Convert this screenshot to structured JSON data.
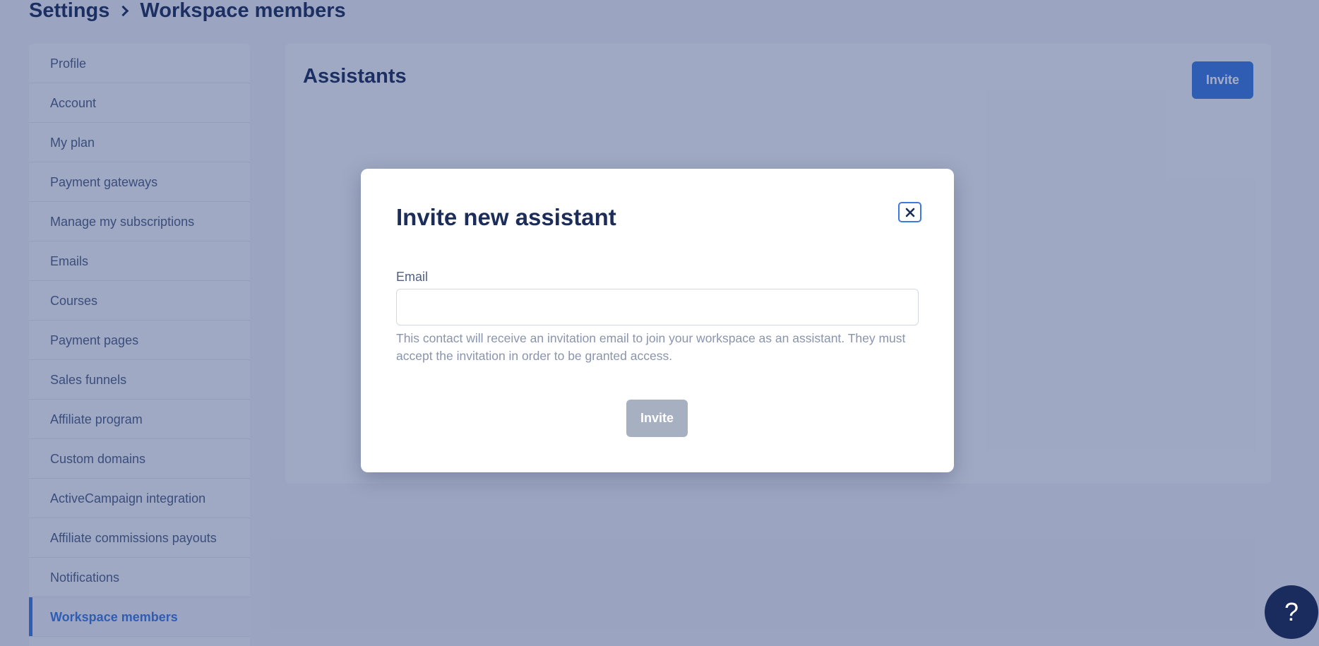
{
  "breadcrumb": {
    "root": "Settings",
    "current": "Workspace members"
  },
  "sidebar": {
    "items": [
      {
        "label": "Profile",
        "active": false
      },
      {
        "label": "Account",
        "active": false
      },
      {
        "label": "My plan",
        "active": false
      },
      {
        "label": "Payment gateways",
        "active": false
      },
      {
        "label": "Manage my subscriptions",
        "active": false
      },
      {
        "label": "Emails",
        "active": false
      },
      {
        "label": "Courses",
        "active": false
      },
      {
        "label": "Payment pages",
        "active": false
      },
      {
        "label": "Sales funnels",
        "active": false
      },
      {
        "label": "Affiliate program",
        "active": false
      },
      {
        "label": "Custom domains",
        "active": false
      },
      {
        "label": "ActiveCampaign integration",
        "active": false
      },
      {
        "label": "Affiliate commissions payouts",
        "active": false
      },
      {
        "label": "Notifications",
        "active": false
      },
      {
        "label": "Workspace members",
        "active": true
      }
    ]
  },
  "main": {
    "title": "Assistants",
    "invite_label": "Invite"
  },
  "modal": {
    "title": "Invite new assistant",
    "close_icon": "close-icon",
    "email_label": "Email",
    "email_value": "",
    "email_placeholder": "",
    "help_text": "This contact will receive an invitation email to join your workspace as an assistant. They must accept the invitation in order to be granted access.",
    "invite_label": "Invite"
  },
  "help_bubble": {
    "label": "?"
  },
  "colors": {
    "accent": "#3b7ae0",
    "navy": "#1c2d5a",
    "overlay": "#1d3170",
    "disabled_button": "#a7b0c1"
  }
}
